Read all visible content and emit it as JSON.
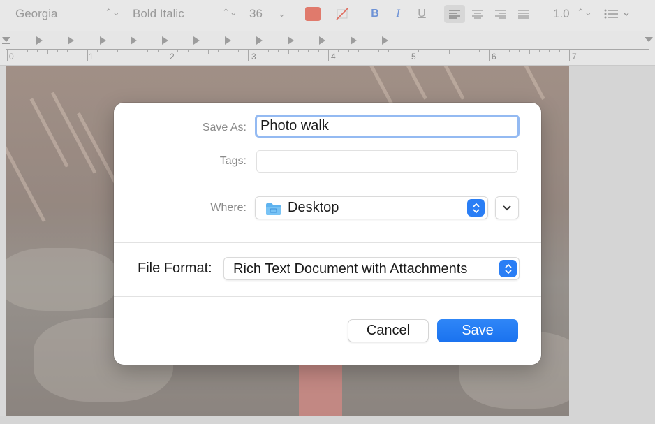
{
  "toolbar": {
    "font_family": "Georgia",
    "font_style": "Bold Italic",
    "font_size": "36",
    "bold_label": "B",
    "italic_label": "I",
    "underline_label": "U",
    "line_spacing": "1.0",
    "text_color": "#e07a6c"
  },
  "ruler": {
    "numbers": [
      "0",
      "1",
      "2",
      "3",
      "4",
      "5",
      "6",
      "7"
    ]
  },
  "dialog": {
    "save_as_label": "Save As:",
    "save_as_value": "Photo walk",
    "tags_label": "Tags:",
    "tags_value": "",
    "where_label": "Where:",
    "where_value": "Desktop",
    "file_format_label": "File Format:",
    "file_format_value": "Rich Text Document with Attachments",
    "cancel_label": "Cancel",
    "save_label": "Save",
    "accent_color": "#2a7ef5"
  }
}
